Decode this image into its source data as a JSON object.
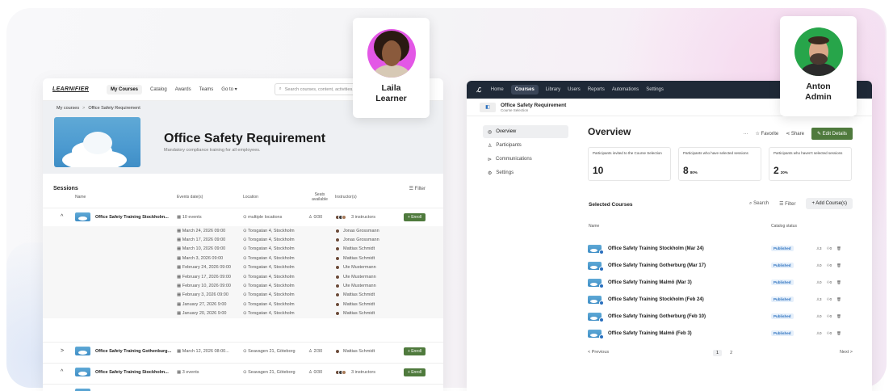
{
  "learner_card": {
    "name_line1": "Laila",
    "name_line2": "Learner",
    "avatar_bg": "#e357e6"
  },
  "admin_card": {
    "name_line1": "Anton",
    "name_line2": "Admin",
    "avatar_bg": "#27a54a"
  },
  "learner_app": {
    "logo": "LEARNIFIER",
    "nav": [
      "My Courses",
      "Catalog",
      "Awards",
      "Teams",
      "Go to ▾"
    ],
    "active_nav": "My Courses",
    "search_placeholder": "Search courses, content, activities...",
    "breadcrumb": [
      "My courses",
      "Office Safety Requirement"
    ],
    "course_title": "Office Safety Requirement",
    "course_subtitle": "Mandatory compliance training for all employees.",
    "sessions_title": "Sessions",
    "filter_label": "Filter",
    "columns": [
      "Name",
      "Events date(s)",
      "Location",
      "Seats available",
      "Instructor(s)"
    ],
    "enroll_label": "+ Enroll",
    "session_1": {
      "name": "Office Safety Training Stockholm...",
      "events": "10 events",
      "location": "multiple locations",
      "seats": "0/30",
      "instructors": "3 instructors"
    },
    "events": [
      {
        "date": "March 24, 2026 09:00",
        "location": "Torsgatan 4, Stockholm",
        "instructor": "Jonas Grossmann"
      },
      {
        "date": "March 17, 2026 09:00",
        "location": "Torsgatan 4, Stockholm",
        "instructor": "Jonas Grossmann"
      },
      {
        "date": "March 10, 2026 09:00",
        "location": "Torsgatan 4, Stockholm",
        "instructor": "Mattias Schmidt"
      },
      {
        "date": "March 3, 2026 09:00",
        "location": "Torsgatan 4, Stockholm",
        "instructor": "Mattias Schmidt"
      },
      {
        "date": "February 24, 2026 09:00",
        "location": "Torsgatan 4, Stockholm",
        "instructor": "Ute Mustermann"
      },
      {
        "date": "February 17, 2026 09:00",
        "location": "Torsgatan 4, Stockholm",
        "instructor": "Ute Mustermann"
      },
      {
        "date": "February 10, 2026 09:00",
        "location": "Torsgatan 4, Stockholm",
        "instructor": "Ute Mustermann"
      },
      {
        "date": "February 3, 2026 09:00",
        "location": "Torsgatan 4, Stockholm",
        "instructor": "Mattias Schmidt"
      },
      {
        "date": "January 27, 2026 9:00",
        "location": "Torsgatan 4, Stockholm",
        "instructor": "Mattias Schmidt"
      },
      {
        "date": "January 20, 2026 9:00",
        "location": "Torsgatan 4, Stockholm",
        "instructor": "Mattias Schmidt"
      }
    ],
    "session_2": {
      "name": "Office Safety Training Gothenburg...",
      "events": "March 12, 2026 08:00...",
      "location": "Seavagen 21, Göteborg",
      "seats": "2/30",
      "instructors": "Mattias Schmidt"
    },
    "session_3": {
      "name": "Office Safety Training Stockholm...",
      "events": "3 events",
      "location": "Seavagen 21, Göteborg",
      "seats": "0/30",
      "instructors": "3 instructors"
    }
  },
  "admin_app": {
    "nav": [
      "Home",
      "Courses",
      "Library",
      "Users",
      "Reports",
      "Automations",
      "Settings"
    ],
    "active_nav": "Courses",
    "selection_title": "Office Safety Requirement",
    "selection_subtitle": "Course Selection",
    "side": [
      "Overview",
      "Participants",
      "Communications",
      "Settings"
    ],
    "overview_title": "Overview",
    "actions": {
      "more": "···",
      "favorite": "Favorite",
      "share": "Share",
      "edit": "Edit Details"
    },
    "stats": [
      {
        "label": "Participants invited to the Course Selection",
        "value": "10",
        "pct": ""
      },
      {
        "label": "Participants who have selected sessions",
        "value": "8",
        "pct": "80%"
      },
      {
        "label": "Participants who haven't selected sessions",
        "value": "2",
        "pct": "20%"
      }
    ],
    "selected_title": "Selected Courses",
    "search_label": "Search",
    "filter_label": "Filter",
    "add_label": "+ Add Course(s)",
    "columns": [
      "Name",
      "Catalog status"
    ],
    "courses": [
      {
        "name": "Office Safety Training Stockholm (Mar 24)",
        "status": "Published",
        "a": "3",
        "b": "0"
      },
      {
        "name": "Office Safety Training Gotherburg (Mar 17)",
        "status": "Published",
        "a": "0",
        "b": "0"
      },
      {
        "name": "Office Safety Training Malmö (Mar 3)",
        "status": "Published",
        "a": "0",
        "b": "0"
      },
      {
        "name": "Office Safety Training Stockholm (Feb 24)",
        "status": "Published",
        "a": "3",
        "b": "0"
      },
      {
        "name": "Office Safety Training Gotherburg (Feb 10)",
        "status": "Published",
        "a": "0",
        "b": "0"
      },
      {
        "name": "Office Safety Training Malmö (Feb 3)",
        "status": "Published",
        "a": "0",
        "b": "0"
      }
    ],
    "pager": {
      "prev": "< Previous",
      "pages": [
        "1",
        "2"
      ],
      "next": "Next >"
    }
  }
}
